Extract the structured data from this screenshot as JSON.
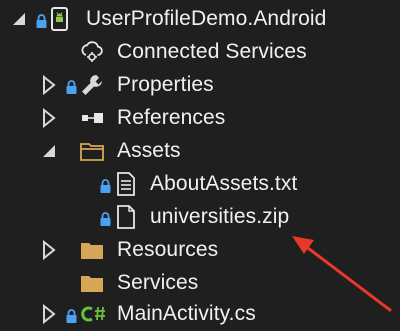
{
  "solution_explorer": {
    "project": {
      "label": "UserProfileDemo.Android"
    },
    "connected_services": {
      "label": "Connected Services"
    },
    "properties": {
      "label": "Properties"
    },
    "references": {
      "label": "References"
    },
    "assets": {
      "label": "Assets",
      "files": [
        {
          "label": "AboutAssets.txt"
        },
        {
          "label": "universities.zip"
        }
      ]
    },
    "resources": {
      "label": "Resources"
    },
    "services": {
      "label": "Services"
    },
    "main_activity": {
      "label": "MainActivity.cs"
    }
  },
  "icons": {
    "expand": "chevron-right-icon",
    "collapse": "triangle-down-icon",
    "lock": "lock-icon",
    "android": "android-project-icon",
    "cloud": "cloud-gear-icon",
    "wrench": "wrench-icon",
    "references": "references-icon",
    "folder": "folder-icon",
    "text_file": "text-file-icon",
    "file": "file-icon",
    "csharp": "csharp-file-icon",
    "annotation": "red-arrow"
  },
  "colors": {
    "background": "#1f1f1f",
    "text": "#f1f1f1",
    "lock": "#4aa3f0",
    "android": "#8cc84b",
    "folder": "#d8a657",
    "csharp": "#68c23a",
    "arrow": "#e8382c"
  }
}
